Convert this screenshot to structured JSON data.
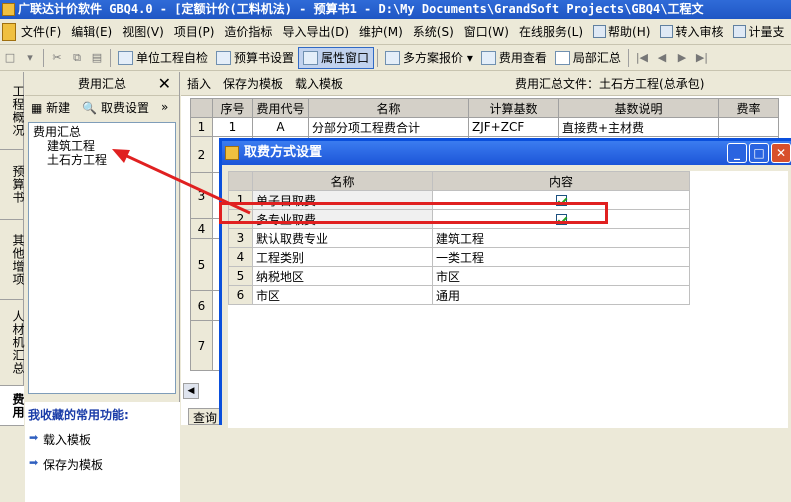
{
  "window": {
    "title": "广联达计价软件 GBQ4.0 - [定额计价(工料机法) - 预算书1 - D:\\My Documents\\GrandSoft Projects\\GBQ4\\工程文"
  },
  "menu": [
    "文件(F)",
    "编辑(E)",
    "视图(V)",
    "项目(P)",
    "造价指标",
    "导入导出(D)",
    "维护(M)",
    "系统(S)",
    "窗口(W)",
    "在线服务(L)",
    "帮助(H)",
    "转入审核",
    "计量支"
  ],
  "toolbar": {
    "b1": "单位工程自检",
    "b2": "预算书设置",
    "b3": "属性窗口",
    "b4": "多方案报价",
    "b5": "费用查看",
    "b6": "局部汇总"
  },
  "vtabs": [
    "工程概况",
    "预算书",
    "其他增项",
    "人材机汇总",
    "费用"
  ],
  "left": {
    "header": "费用汇总",
    "close": "✕",
    "new": "新建",
    "fee_settings": "取费设置",
    "tree_root": "费用汇总",
    "tree_children": [
      "建筑工程",
      "土石方工程"
    ],
    "fav_title": "我收藏的常用功能:",
    "fav_items": [
      "载入模板",
      "保存为模板"
    ]
  },
  "main": {
    "insert": "插入",
    "save_tpl": "保存为模板",
    "load_tpl": "载入模板",
    "sum_file": "费用汇总文件：土石方工程(总承包)",
    "headers": [
      "序号",
      "费用代号",
      "名称",
      "计算基数",
      "基数说明",
      "费率"
    ],
    "rows": [
      [
        "1",
        "1",
        "A",
        "分部分项工程费合计",
        "ZJF+ZCF",
        "直接费+主材费"
      ],
      [
        "2",
        "",
        "",
        "",
        "",
        ""
      ],
      [
        "3",
        "",
        "",
        "",
        "",
        ""
      ],
      [
        "4",
        "",
        "",
        "",
        "",
        ""
      ],
      [
        "5",
        "",
        "",
        "",
        "",
        ""
      ],
      [
        "6",
        "",
        "",
        "",
        "",
        ""
      ],
      [
        "7",
        "",
        "",
        "",
        "",
        ""
      ]
    ],
    "query": "查询"
  },
  "dialog": {
    "title": "取费方式设置",
    "col_name": "名称",
    "col_content": "内容",
    "rows": [
      {
        "n": "1",
        "name": "单子目取费",
        "content": "",
        "checked": true
      },
      {
        "n": "2",
        "name": "多专业取费",
        "content": "",
        "checked": true
      },
      {
        "n": "3",
        "name": "默认取费专业",
        "content": "建筑工程",
        "checked": false
      },
      {
        "n": "4",
        "name": "工程类别",
        "content": "一类工程",
        "checked": false
      },
      {
        "n": "5",
        "name": "纳税地区",
        "content": "市区",
        "checked": false
      },
      {
        "n": "6",
        "name": "市区",
        "content": "通用",
        "checked": false
      }
    ]
  }
}
